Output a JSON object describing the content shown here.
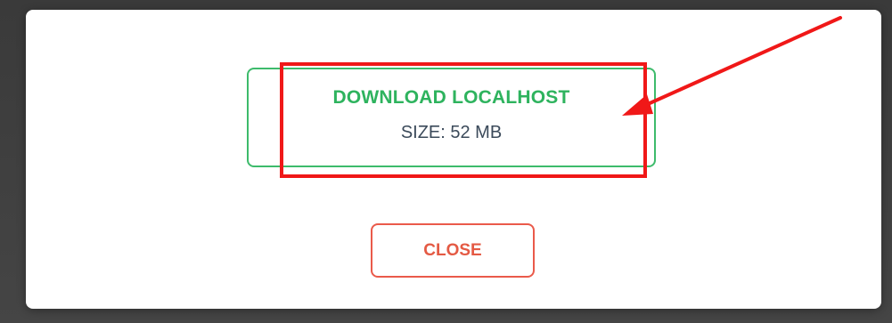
{
  "dialog": {
    "download_title": "DOWNLOAD LOCALHOST",
    "download_size": "SIZE: 52 MB",
    "close_label": "CLOSE"
  },
  "colors": {
    "download_accent": "#3dbb6b",
    "close_accent": "#ea5a4a",
    "annotation": "#f01818"
  }
}
